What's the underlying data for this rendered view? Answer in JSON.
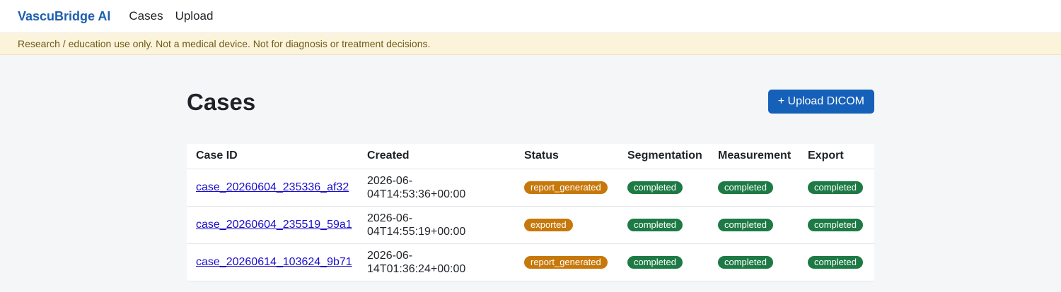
{
  "nav": {
    "brand": "VascuBridge AI",
    "links": [
      "Cases",
      "Upload"
    ]
  },
  "disclaimer": "Research / education use only. Not a medical device. Not for diagnosis or treatment decisions.",
  "page": {
    "title": "Cases",
    "upload_button": "+ Upload DICOM"
  },
  "table": {
    "headers": [
      "Case ID",
      "Created",
      "Status",
      "Segmentation",
      "Measurement",
      "Export"
    ],
    "rows": [
      {
        "case_id": "case_20260604_235336_af32",
        "created_line1": "2026-06-",
        "created_line2": "04T14:53:36+00:00",
        "status": "report_generated",
        "segmentation": "completed",
        "measurement": "completed",
        "export": "completed"
      },
      {
        "case_id": "case_20260604_235519_59a1",
        "created_line1": "2026-06-",
        "created_line2": "04T14:55:19+00:00",
        "status": "exported",
        "segmentation": "completed",
        "measurement": "completed",
        "export": "completed"
      },
      {
        "case_id": "case_20260614_103624_9b71",
        "created_line1": "2026-06-",
        "created_line2": "14T01:36:24+00:00",
        "status": "report_generated",
        "segmentation": "completed",
        "measurement": "completed",
        "export": "completed"
      }
    ]
  },
  "colors": {
    "brand": "#1d5fae",
    "primary_button": "#1560b8",
    "status_amber": "#c7780b",
    "status_green": "#1d7a45",
    "disclaimer_bg": "#fcf4da"
  }
}
